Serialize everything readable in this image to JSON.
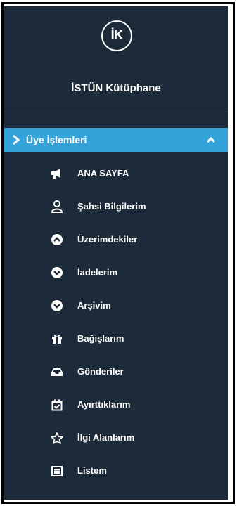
{
  "brand": {
    "logo_text": "İK",
    "name": "İSTÜN Kütüphane"
  },
  "section": {
    "label": "Üye İşlemleri",
    "accent": "#33a3da",
    "expanded": true
  },
  "menu": {
    "items": [
      {
        "label": "ANA SAYFA",
        "icon": "megaphone-icon"
      },
      {
        "label": "Şahsi Bilgilerim",
        "icon": "user-icon"
      },
      {
        "label": "Üzerimdekiler",
        "icon": "chevron-up-circle-icon"
      },
      {
        "label": "İadelerim",
        "icon": "chevron-down-circle-icon"
      },
      {
        "label": "Arşivim",
        "icon": "chevron-down-circle-icon"
      },
      {
        "label": "Bağışlarım",
        "icon": "gift-icon"
      },
      {
        "label": "Gönderiler",
        "icon": "inbox-icon"
      },
      {
        "label": "Ayırttıklarım",
        "icon": "calendar-check-icon"
      },
      {
        "label": "İlgi Alanlarım",
        "icon": "star-icon"
      },
      {
        "label": "Listem",
        "icon": "list-icon"
      }
    ]
  },
  "colors": {
    "sidebar_bg": "#1c2a39",
    "text": "#ffffff"
  }
}
